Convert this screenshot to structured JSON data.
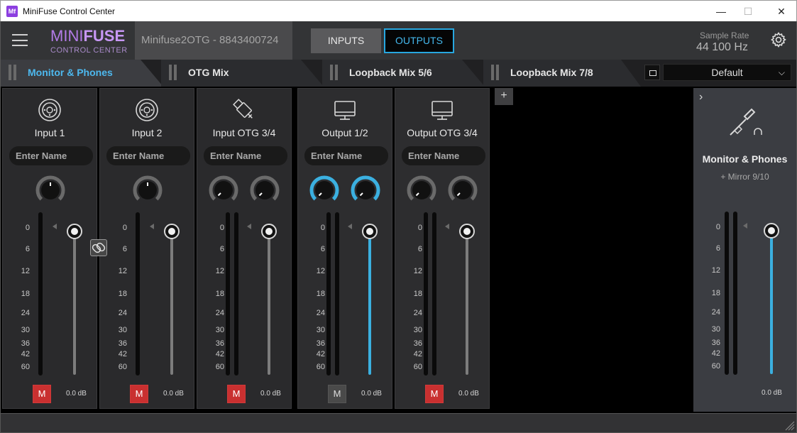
{
  "window": {
    "title": "MiniFuse Control Center",
    "app_icon_text": "Mf",
    "minimize": "—",
    "maximize": "☐",
    "close": "✕"
  },
  "header": {
    "logo_mini": "MINI",
    "logo_fuse": "FUSE",
    "logo_sub": "CONTROL CENTER",
    "device_name": "Minifuse2OTG - 8843400724",
    "inputs_label": "INPUTS",
    "outputs_label": "OUTPUTS",
    "sample_rate_label": "Sample Rate",
    "sample_rate_value": "44 100 Hz"
  },
  "tabs": [
    {
      "label": "Monitor & Phones",
      "active": true
    },
    {
      "label": "OTG Mix",
      "active": false
    },
    {
      "label": "Loopback Mix 5/6",
      "active": false
    },
    {
      "label": "Loopback Mix 7/8",
      "active": false
    }
  ],
  "preset": {
    "value": "Default"
  },
  "scale_labels": [
    "0",
    "6",
    "12",
    "18",
    "24",
    "30",
    "36",
    "42",
    "60"
  ],
  "strips": [
    {
      "name": "Input 1",
      "placeholder": "Enter Name",
      "icon": "xlr-combo-jack-icon",
      "mute": "M",
      "muted": true,
      "gain_db": "0.0 dB",
      "stereo": false
    },
    {
      "name": "Input 2",
      "placeholder": "Enter Name",
      "icon": "xlr-combo-jack-icon",
      "mute": "M",
      "muted": true,
      "gain_db": "0.0 dB",
      "stereo": false
    },
    {
      "name": "Input OTG 3/4",
      "placeholder": "Enter Name",
      "icon": "usb-icon",
      "mute": "M",
      "muted": true,
      "gain_db": "0.0 dB",
      "stereo": true
    },
    {
      "name": "Output 1/2",
      "placeholder": "Enter Name",
      "icon": "monitor-icon",
      "mute": "M",
      "muted": false,
      "gain_db": "0.0 dB",
      "stereo": true
    },
    {
      "name": "Output OTG 3/4",
      "placeholder": "Enter Name",
      "icon": "monitor-icon",
      "mute": "M",
      "muted": true,
      "gain_db": "0.0 dB",
      "stereo": true
    }
  ],
  "add_button": "+",
  "monitor_panel": {
    "title": "Monitor & Phones",
    "subtitle": "+ Mirror 9/10",
    "gain_db": "0.0 dB",
    "expand": "›"
  },
  "colors": {
    "accent_blue": "#3bb0e0",
    "mute_red": "#c93030",
    "logo_purple": "#b37be8"
  }
}
